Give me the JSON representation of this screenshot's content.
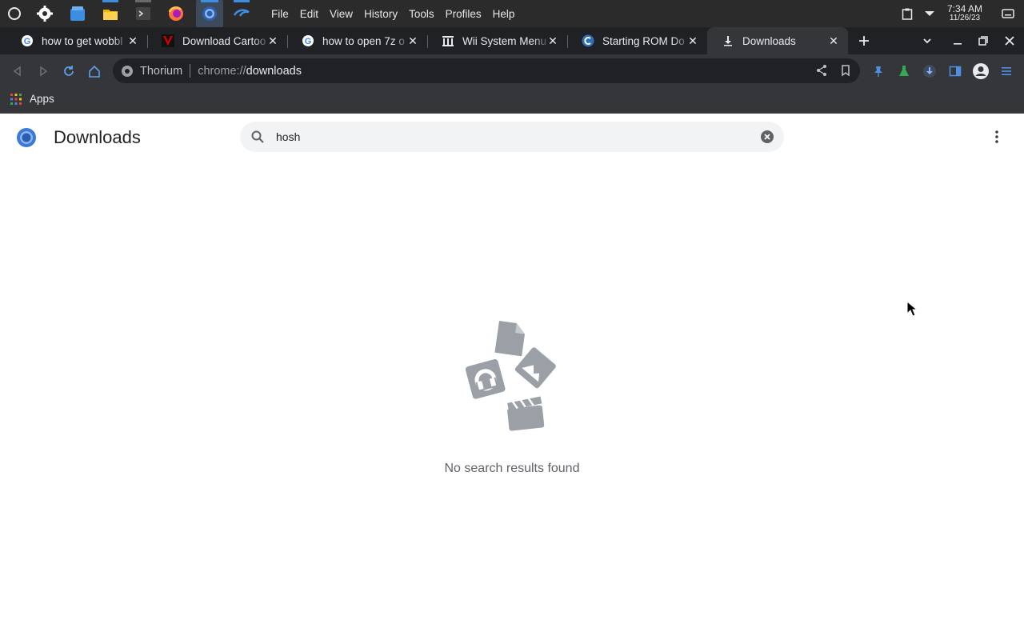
{
  "system": {
    "menu": [
      "File",
      "Edit",
      "View",
      "History",
      "Tools",
      "Profiles",
      "Help"
    ],
    "clock_time": "7:34 AM",
    "clock_date": "11/26/23"
  },
  "tabs": [
    {
      "title": "how to get wobbl",
      "favicon": "google-icon"
    },
    {
      "title": "Download Cartoo",
      "favicon": "vimm-icon"
    },
    {
      "title": "how to open 7z o",
      "favicon": "google-icon"
    },
    {
      "title": "Wii System Menu",
      "favicon": "archive-icon"
    },
    {
      "title": "Starting ROM Do",
      "favicon": "c-icon"
    },
    {
      "title": "Downloads",
      "favicon": "download-icon",
      "active": true
    }
  ],
  "omnibox": {
    "site": "Thorium",
    "url_scheme": "chrome://",
    "url_path": "downloads"
  },
  "bookmarks": {
    "apps_label": "Apps"
  },
  "page": {
    "title": "Downloads",
    "search_value": "hosh",
    "empty_message": "No search results found"
  },
  "colors": {
    "accent": "#8ab4f8",
    "empty_art": "#9aa0a6"
  }
}
